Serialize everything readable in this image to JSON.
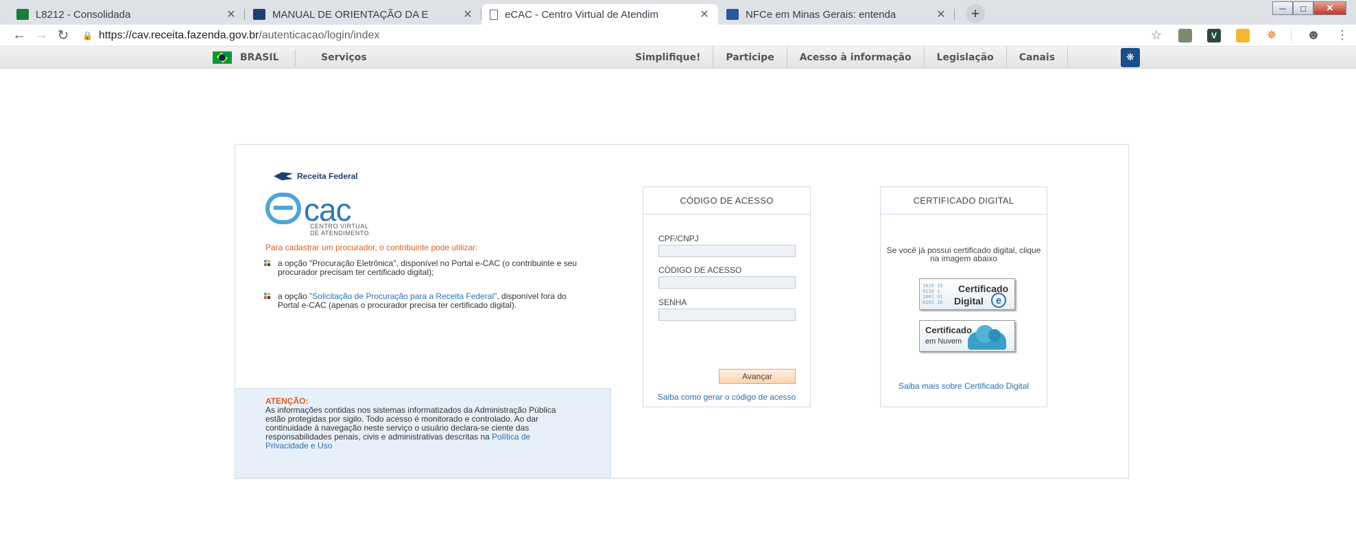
{
  "browser": {
    "tabs": [
      {
        "title": "L8212 - Consolidada",
        "active": false
      },
      {
        "title": "MANUAL DE ORIENTAÇÃO DA E",
        "active": false
      },
      {
        "title": "eCAC - Centro Virtual de Atendim",
        "active": true
      },
      {
        "title": "NFCe em Minas Gerais: entenda",
        "active": false
      }
    ],
    "close_glyph": "✕",
    "new_tab_glyph": "+",
    "url_domain": "https://cav.receita.fazenda.gov.br",
    "url_path": "/autenticacao/login/index"
  },
  "gov_bar": {
    "brasil": "BRASIL",
    "servicos": "Serviços",
    "links": [
      "Simplifique!",
      "Participe",
      "Acesso à informação",
      "Legislação",
      "Canais"
    ]
  },
  "left": {
    "rf_logo_text": "Receita Federal",
    "ecac_word": "cac",
    "ecac_sub1": "CENTRO VIRTUAL",
    "ecac_sub2": "DE ATENDIMENTO",
    "intro": "Para cadastrar um procurador, o contribuinte pode utilizar:",
    "opt1": "a opção \"Procuração Eletrônica\", disponível no Portal e-CAC (o contribuinte e seu procurador precisam ter certificado digital);",
    "opt2_prefix": "a opção ",
    "opt2_link": "\"Solicitação de Procuração para a Receita Federal\"",
    "opt2_suffix": ", disponível fora do Portal e-CAC (apenas o procurador precisa ter certificado digital)."
  },
  "attention": {
    "title": "ATENÇÃO:",
    "text": "As informações contidas nos sistemas informatizados da Administração Pública estão protegidas por sigilo. Todo acesso é monitorado e controlado. Ao dar continuidade à navegação neste serviço o usuário declara-se ciente das responsabilidades penais, civis e administrativas descritas na ",
    "link": "Política de Privacidade e Uso"
  },
  "codigo": {
    "header": "CÓDIGO DE ACESSO",
    "cpf_label": "CPF/CNPJ",
    "codigo_label": "CÓDIGO DE ACESSO",
    "senha_label": "SENHA",
    "button": "Avançar",
    "link": "Saiba como gerar o código de acesso"
  },
  "certificado": {
    "header": "CERTIFICADO DIGITAL",
    "text": "Se você já possui certificado digital, clique na imagem abaixo",
    "img1_line1": "Certificado",
    "img1_line2": "Digital",
    "img2_line1": "Certificado",
    "img2_line2": "em Nuvem",
    "link": "Saiba mais sobre Certificado Digital"
  }
}
